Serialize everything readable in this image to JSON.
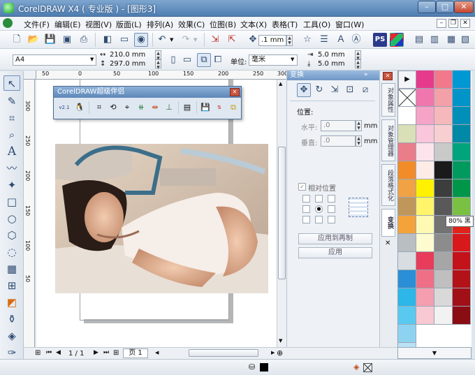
{
  "window": {
    "title": "CorelDRAW X4 ( 专业版 ) - [图形3]",
    "min": "–",
    "max": "□",
    "close": "✕"
  },
  "menu": [
    "文件(F)",
    "编辑(E)",
    "视图(V)",
    "版面(L)",
    "排列(A)",
    "效果(C)",
    "位图(B)",
    "文本(X)",
    "表格(T)",
    "工具(O)",
    "窗口(W)"
  ],
  "toolbar": {
    "nudge": ".1 mm"
  },
  "propbar": {
    "page_size": "A4",
    "width": "210.0 mm",
    "height": "297.0 mm",
    "units_label": "单位:",
    "units": "毫米",
    "dup_x": "5.0 mm",
    "dup_y": "5.0 mm"
  },
  "ruler": {
    "h": [
      "50",
      "0",
      "50",
      "100",
      "150",
      "200",
      "250",
      "300"
    ],
    "v": [
      "300",
      "250",
      "200",
      "150",
      "100",
      "50"
    ]
  },
  "float_window": {
    "title": "CorelDRAW超级伴侣",
    "version": "v2.1"
  },
  "docker": {
    "title": "变换",
    "position_label": "位置:",
    "h_label": "水平:",
    "h_value": ".0",
    "v_label": "垂直:",
    "v_value": ".0",
    "unit": "mm",
    "relative_label": "相对位置",
    "apply_dup": "应用到再制",
    "apply": "应用"
  },
  "side_tabs": [
    "对象属性",
    "对象管理器",
    "段落格式化",
    "变换"
  ],
  "palette": {
    "columns": [
      [
        "#ffffff",
        "#d9e0b7",
        "#e97d8a",
        "#f28c28",
        "#f0a244",
        "#c0975a",
        "#f4a23a",
        "#b9bec3",
        "#d8dde2",
        "#2a8fd6",
        "#2db6e8",
        "#5ac9f0",
        "#8dd3f1",
        "#b9e2f5"
      ],
      [
        "#e63b8c",
        "#ef77ad",
        "#f5a3c6",
        "#f9c6da",
        "#fde3ec",
        "#fdebe8",
        "#fff100",
        "#fff46a",
        "#fff9b4",
        "#fffbd0",
        "#e73c5a",
        "#ee6f86",
        "#f49eb0",
        "#f8c8d3"
      ],
      [
        "#f2788b",
        "#f4a0a8",
        "#f6b8bb",
        "#f8cfd1",
        "#c9c9c9",
        "#1a1a1a",
        "#3d3d3d",
        "#595959",
        "#737373",
        "#8c8c8c",
        "#a6a6a6",
        "#bfbfbf",
        "#d9d9d9",
        "#f2f2f2"
      ],
      [
        "#0098d4",
        "#0094c8",
        "#008fb8",
        "#0089a6",
        "#00a47c",
        "#009a5e",
        "#00964a",
        "#7ac143",
        "#e2231a",
        "#d7191c",
        "#c4121a",
        "#b31219",
        "#a10f17",
        "#8b0d14"
      ]
    ],
    "tooltip": "80% 黑"
  },
  "bottom": {
    "page_count": "1 / 1",
    "page_tab": "页 1"
  }
}
